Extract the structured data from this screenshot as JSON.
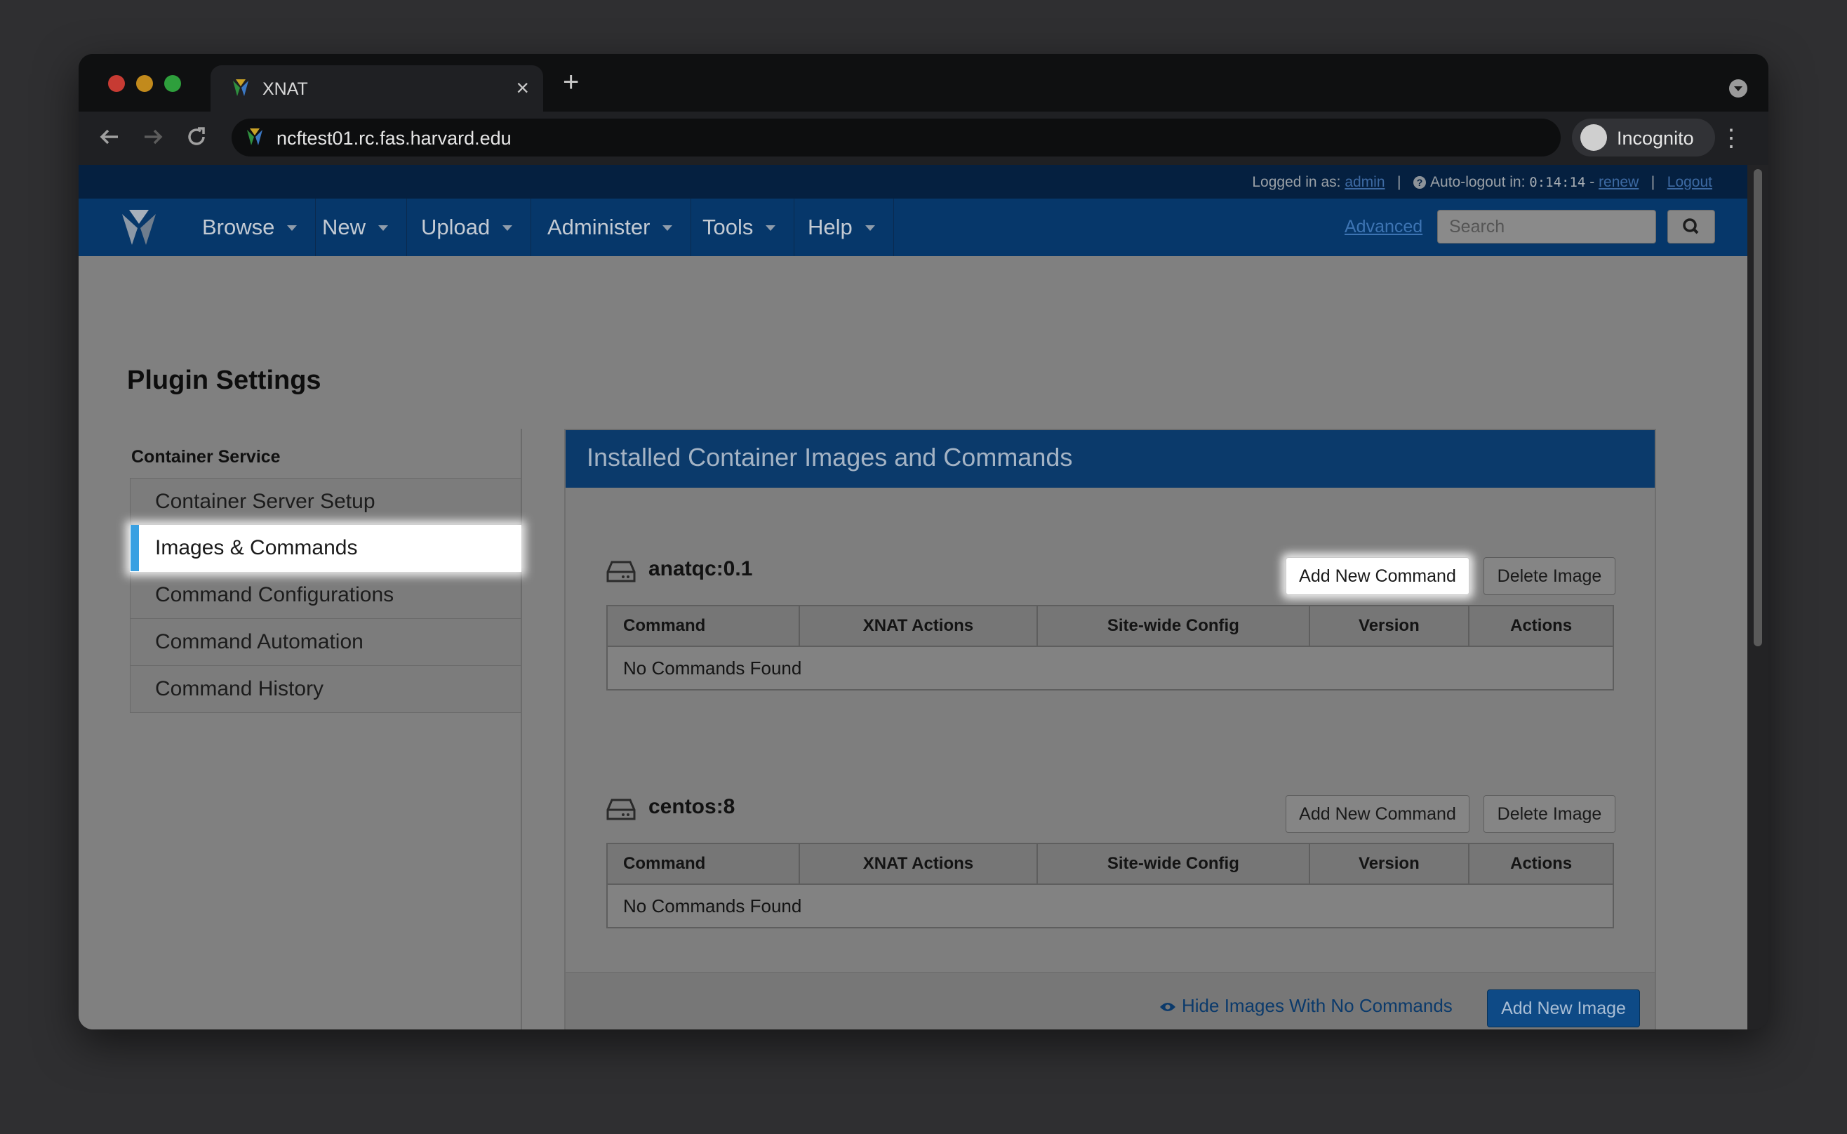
{
  "browser": {
    "tab_title": "XNAT",
    "tab_close": "×",
    "new_tab": "+",
    "url": "ncftest01.rc.fas.harvard.edu",
    "profile_label": "Incognito",
    "back_icon": "arrow-left-icon",
    "forward_icon": "arrow-right-icon",
    "reload_icon": "reload-icon",
    "menu_icon": "kebab-menu-icon"
  },
  "topbar": {
    "logged_in_prefix": "Logged in as:",
    "username": "admin",
    "separator": "|",
    "auto_logout_label": "Auto-logout in:",
    "timer": "0:14:14",
    "dash": "-",
    "renew": "renew",
    "logout": "Logout"
  },
  "navbar": {
    "items": [
      {
        "label": "Browse"
      },
      {
        "label": "New"
      },
      {
        "label": "Upload"
      },
      {
        "label": "Administer"
      },
      {
        "label": "Tools"
      },
      {
        "label": "Help"
      }
    ],
    "advanced": "Advanced",
    "search_placeholder": "Search"
  },
  "page": {
    "title": "Plugin Settings"
  },
  "sidebar": {
    "heading": "Container Service",
    "items": [
      {
        "label": "Container Server Setup",
        "active": false
      },
      {
        "label": "Images & Commands",
        "active": true
      },
      {
        "label": "Command Configurations",
        "active": false
      },
      {
        "label": "Command Automation",
        "active": false
      },
      {
        "label": "Command History",
        "active": false
      }
    ]
  },
  "panel": {
    "title": "Installed Container Images and Commands",
    "table_headers": [
      "Command",
      "XNAT Actions",
      "Site-wide Config",
      "Version",
      "Actions"
    ],
    "images": [
      {
        "name": "anatqc:0.1",
        "empty_text": "No Commands Found",
        "add_command": "Add New Command",
        "delete_image": "Delete Image"
      },
      {
        "name": "centos:8",
        "empty_text": "No Commands Found",
        "add_command": "Add New Command",
        "delete_image": "Delete Image"
      }
    ],
    "hide_link": "Hide Images With No Commands",
    "add_image": "Add New Image"
  },
  "colors": {
    "navbar": "#06376a",
    "active_indicator": "#39a0e2",
    "panel_header": "#0b3a6b"
  }
}
